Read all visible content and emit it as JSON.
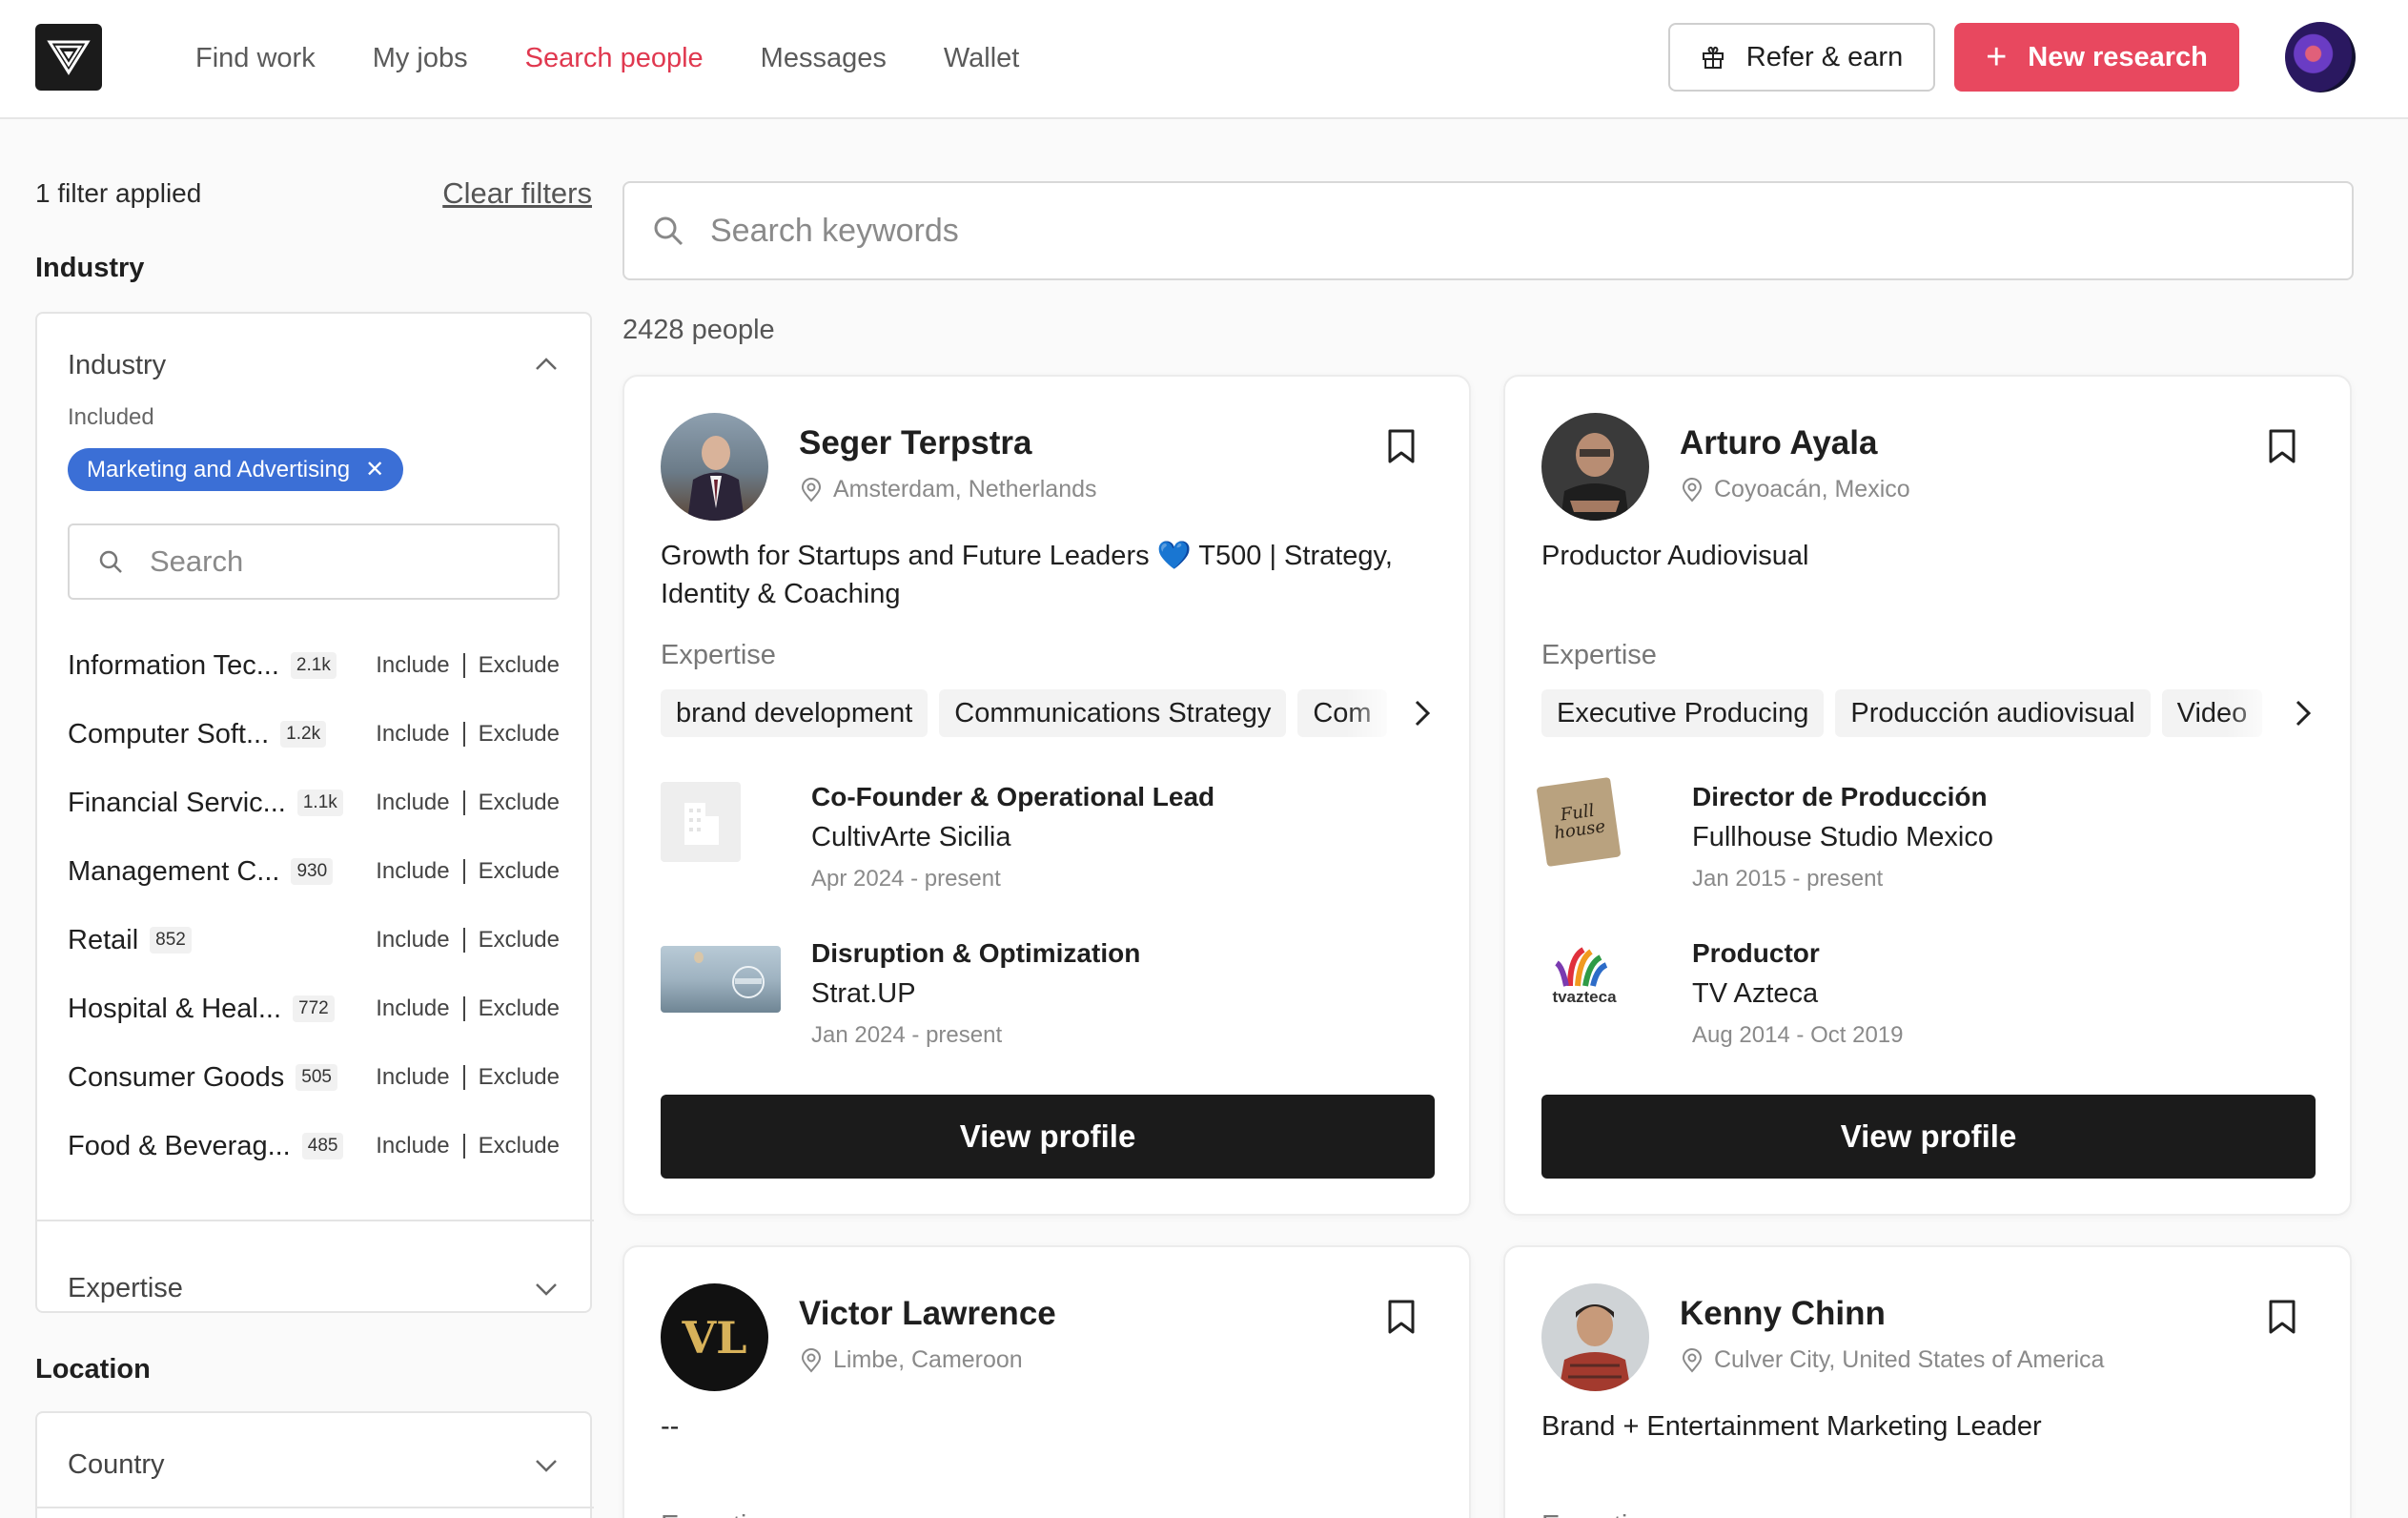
{
  "header": {
    "logo_icon": "triangle-logo-icon",
    "nav": [
      {
        "label": "Find work",
        "active": false
      },
      {
        "label": "My jobs",
        "active": false
      },
      {
        "label": "Search people",
        "active": true
      },
      {
        "label": "Messages",
        "active": false
      },
      {
        "label": "Wallet",
        "active": false
      }
    ],
    "refer_label": "Refer & earn",
    "new_research_label": "New research",
    "accent_color": "#e8485f"
  },
  "sidebar": {
    "filter_count": "1 filter applied",
    "clear_filters": "Clear filters",
    "industry_section_title": "Industry",
    "industry_panel": {
      "title": "Industry",
      "included_label": "Included",
      "chip_label": "Marketing and Advertising",
      "search_placeholder": "Search",
      "include_label": "Include",
      "exclude_label": "Exclude",
      "items": [
        {
          "name": "Information Tec...",
          "count": "2.1k"
        },
        {
          "name": "Computer Soft...",
          "count": "1.2k"
        },
        {
          "name": "Financial Servic...",
          "count": "1.1k"
        },
        {
          "name": "Management C...",
          "count": "930"
        },
        {
          "name": "Retail",
          "count": "852"
        },
        {
          "name": "Hospital & Heal...",
          "count": "772"
        },
        {
          "name": "Consumer Goods",
          "count": "505"
        },
        {
          "name": "Food & Beverag...",
          "count": "485"
        }
      ]
    },
    "expertise_panel_title": "Expertise",
    "location_section_title": "Location",
    "country_panel_title": "Country"
  },
  "main": {
    "search_placeholder": "Search keywords",
    "people_count": "2428 people",
    "expertise_label": "Expertise",
    "view_profile_label": "View profile",
    "cards": [
      {
        "name": "Seger Terpstra",
        "location": "Amsterdam, Netherlands",
        "headline": "Growth for Startups and Future Leaders 💙 T500 | Strategy, Identity & Coaching",
        "tags": [
          "brand development",
          "Communications Strategy",
          "Com"
        ],
        "jobs": [
          {
            "title": "Co-Founder & Operational Lead",
            "company": "CultivArte Sicilia",
            "dates": "Apr 2024 - present"
          },
          {
            "title": "Disruption & Optimization",
            "company": "Strat.UP",
            "dates": "Jan 2024 - present"
          }
        ]
      },
      {
        "name": "Arturo Ayala",
        "location": "Coyoacán, Mexico",
        "headline": "Productor Audiovisual",
        "tags": [
          "Executive Producing",
          "Producción audiovisual",
          "Video"
        ],
        "jobs": [
          {
            "title": "Director de Producción",
            "company": "Fullhouse Studio Mexico",
            "dates": "Jan 2015 - present",
            "logo_text": "Full house"
          },
          {
            "title": "Productor",
            "company": "TV Azteca",
            "dates": "Aug 2014 - Oct 2019",
            "logo_text": "tvazteca"
          }
        ]
      },
      {
        "name": "Victor Lawrence",
        "location": "Limbe, Cameroon",
        "headline": "--",
        "initials": "VL",
        "tags": [],
        "jobs": []
      },
      {
        "name": "Kenny Chinn",
        "location": "Culver City, United States of America",
        "headline": "Brand + Entertainment Marketing Leader",
        "tags": [],
        "jobs": []
      }
    ]
  }
}
